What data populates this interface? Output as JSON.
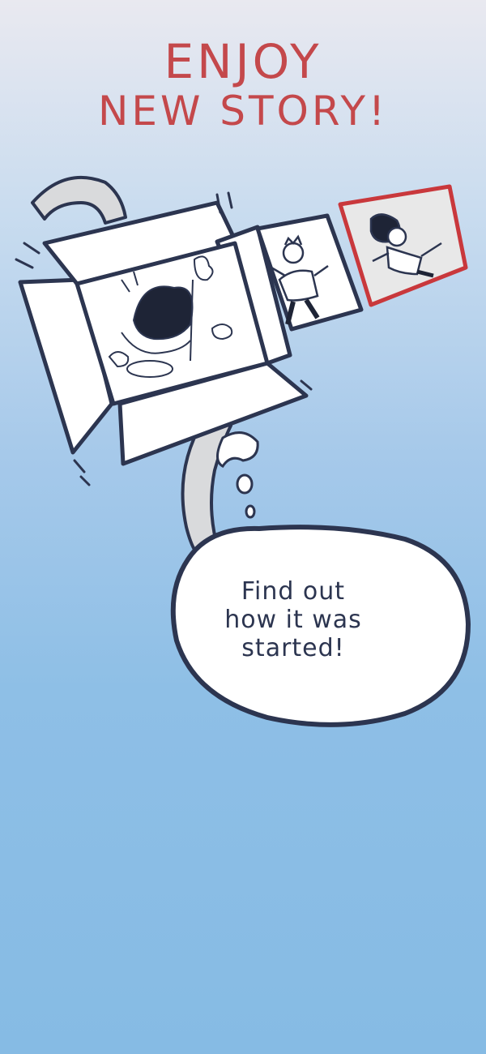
{
  "banner": {
    "title_line1": "ENJOY",
    "title_line2": "NEW STORY!",
    "bubble_text": "Find out how it was started!"
  },
  "colors": {
    "title": "#c4484b",
    "ink": "#2c3550",
    "frame_highlight": "#c9383c",
    "panel_fill": "#ffffff",
    "tail_fill": "#d9dadc"
  },
  "icons": [
    "opened-box-icon",
    "comic-panel-illustration",
    "thought-bubble-icon"
  ]
}
